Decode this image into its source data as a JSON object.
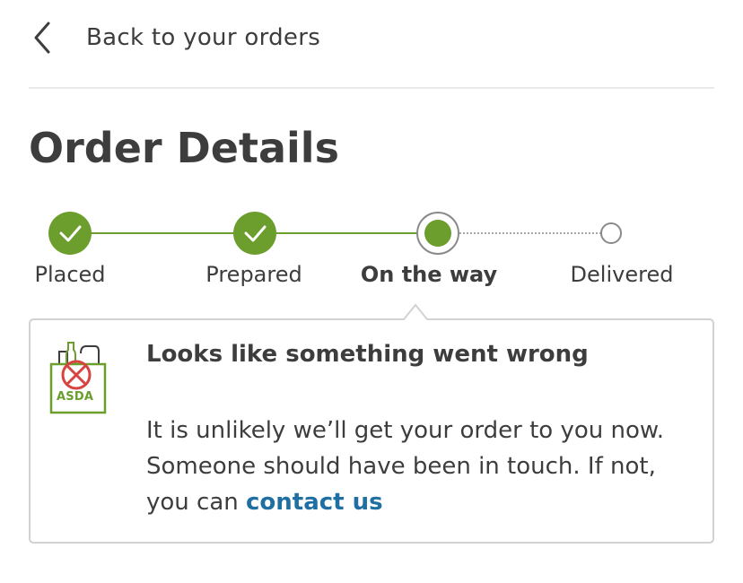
{
  "nav": {
    "back_label": "Back to your orders"
  },
  "page": {
    "title": "Order Details"
  },
  "tracker": {
    "steps": [
      {
        "label": "Placed",
        "state": "complete"
      },
      {
        "label": "Prepared",
        "state": "complete"
      },
      {
        "label": "On the way",
        "state": "current"
      },
      {
        "label": "Delivered",
        "state": "pending"
      }
    ]
  },
  "alert": {
    "title": "Looks like something went wrong",
    "body_line_1": "It is unlikely we’ll get your order to you now.",
    "body_line_2": "Someone should have been in touch. If not,",
    "body_line_3_prefix": "you can ",
    "contact_link": "contact us",
    "icon_text": "ASDA",
    "icon": "asda-bag-error-icon"
  },
  "colors": {
    "accent_green": "#6c9e2e",
    "link_blue": "#1f6fa3",
    "text": "#3d3d3d",
    "error_red": "#d9433f"
  }
}
